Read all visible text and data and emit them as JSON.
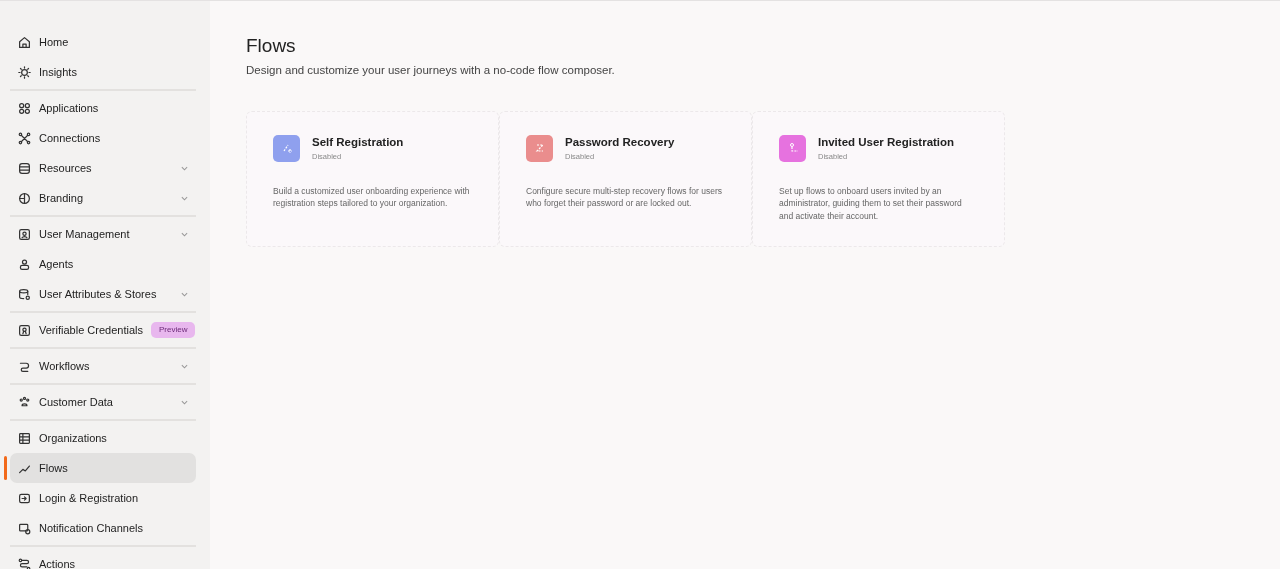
{
  "sidebar": {
    "groups": [
      {
        "items": [
          {
            "label": "Home",
            "kind": "link",
            "selected": false
          },
          {
            "label": "Insights",
            "kind": "link",
            "selected": false
          }
        ]
      },
      {
        "items": [
          {
            "label": "Applications",
            "kind": "link",
            "selected": false
          },
          {
            "label": "Connections",
            "kind": "link",
            "selected": false
          },
          {
            "label": "Resources",
            "kind": "group",
            "selected": false
          },
          {
            "label": "Branding",
            "kind": "group",
            "selected": false
          }
        ]
      },
      {
        "items": [
          {
            "label": "User Management",
            "kind": "group",
            "selected": false
          },
          {
            "label": "Agents",
            "kind": "link",
            "selected": false
          },
          {
            "label": "User Attributes & Stores",
            "kind": "group",
            "selected": false
          }
        ]
      },
      {
        "items": [
          {
            "label": "Verifiable Credentials",
            "kind": "link",
            "selected": false,
            "badge": "Preview"
          }
        ]
      },
      {
        "items": [
          {
            "label": "Workflows",
            "kind": "group",
            "selected": false
          }
        ]
      },
      {
        "items": [
          {
            "label": "Customer Data",
            "kind": "group",
            "selected": false
          }
        ]
      },
      {
        "items": [
          {
            "label": "Organizations",
            "kind": "link",
            "selected": false
          },
          {
            "label": "Flows",
            "kind": "link",
            "selected": true
          },
          {
            "label": "Login & Registration",
            "kind": "link",
            "selected": false
          },
          {
            "label": "Notification Channels",
            "kind": "link",
            "selected": false
          }
        ]
      },
      {
        "items": [
          {
            "label": "Actions",
            "kind": "link",
            "selected": false
          }
        ]
      }
    ]
  },
  "page": {
    "title": "Flows",
    "subtitle": "Design and customize your user journeys with a no-code flow composer."
  },
  "cards": [
    {
      "title": "Self Registration",
      "status": "Disabled",
      "color": "#8fa0ee",
      "description": "Build a customized user onboarding experience with registration steps tailored to your organization."
    },
    {
      "title": "Password Recovery",
      "status": "Disabled",
      "color": "#ea8d8d",
      "description": "Configure secure multi-step recovery flows for users who forget their password or are locked out."
    },
    {
      "title": "Invited User Registration",
      "status": "Disabled",
      "color": "#e672df",
      "description": "Set up flows to onboard users invited by an administrator, guiding them to set their password and activate their account."
    }
  ]
}
